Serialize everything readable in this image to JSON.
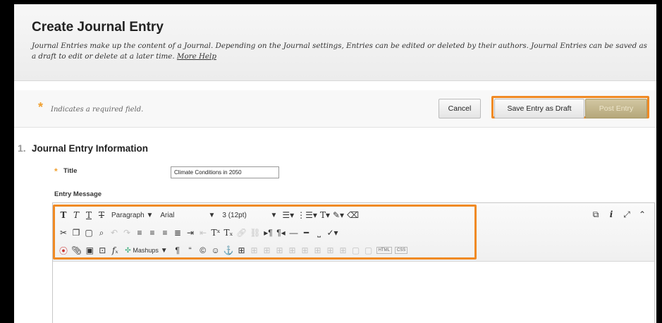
{
  "page": {
    "title": "Create Journal Entry",
    "description": "Journal Entries make up the content of a Journal. Depending on the Journal settings, Entries can be edited or deleted by their authors. Journal Entries can be saved as a draft to edit or delete at a later time.",
    "help_link": "More Help"
  },
  "required_note": {
    "star": "*",
    "text": "Indicates a required field."
  },
  "actions": {
    "cancel": "Cancel",
    "save_draft": "Save Entry as Draft",
    "post": "Post Entry"
  },
  "section": {
    "number": "1.",
    "title": "Journal Entry Information"
  },
  "fields": {
    "title_star": "*",
    "title_label": "Title",
    "title_value": "Climate Conditions in 2050",
    "message_label": "Entry Message"
  },
  "toolbar": {
    "paragraph": "Paragraph",
    "font": "Arial",
    "size": "3 (12pt)",
    "mashups": "Mashups",
    "html": "HTML",
    "css": "CSS"
  },
  "colors": {
    "highlight": "#f08a24",
    "star": "#f0a030"
  }
}
